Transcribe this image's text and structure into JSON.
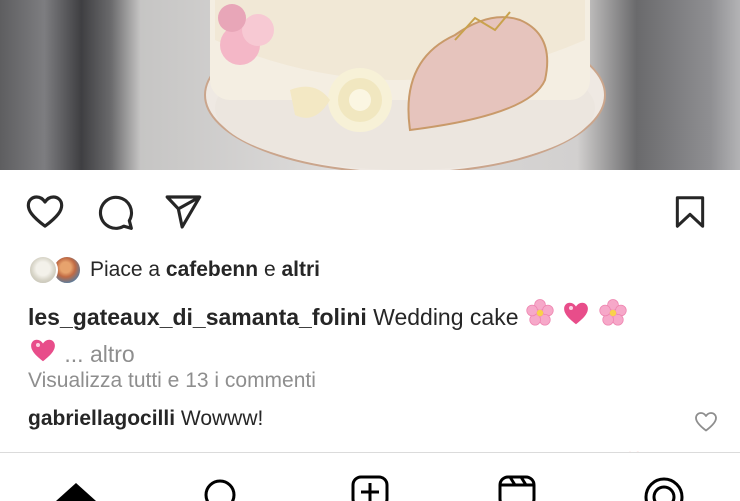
{
  "post": {
    "image_alt": "Wedding cake photo",
    "liked_by_prefix": "Piace a",
    "liked_by_user": "cafebenn",
    "liked_by_conj": "e",
    "liked_by_others": "altri",
    "caption_user": "les_gateaux_di_samanta_folini",
    "caption_text": "Wedding cake",
    "caption_more_ellipsis": "...",
    "caption_more": "altro",
    "view_comments": "Visualizza tutti e 13 i commenti",
    "comment_user": "gabriellagocilli",
    "comment_text": "Wowww!"
  },
  "icons": {
    "like": "heart-outline",
    "comment": "speech-bubble",
    "share": "paper-plane",
    "save": "bookmark",
    "nav": [
      "home",
      "search",
      "new-post",
      "reels",
      "profile"
    ]
  },
  "colors": {
    "text": "#262626",
    "muted": "#8e8e8e",
    "heart_pink": "#e84d8a",
    "blossom_pink": "#f6a8c9"
  }
}
